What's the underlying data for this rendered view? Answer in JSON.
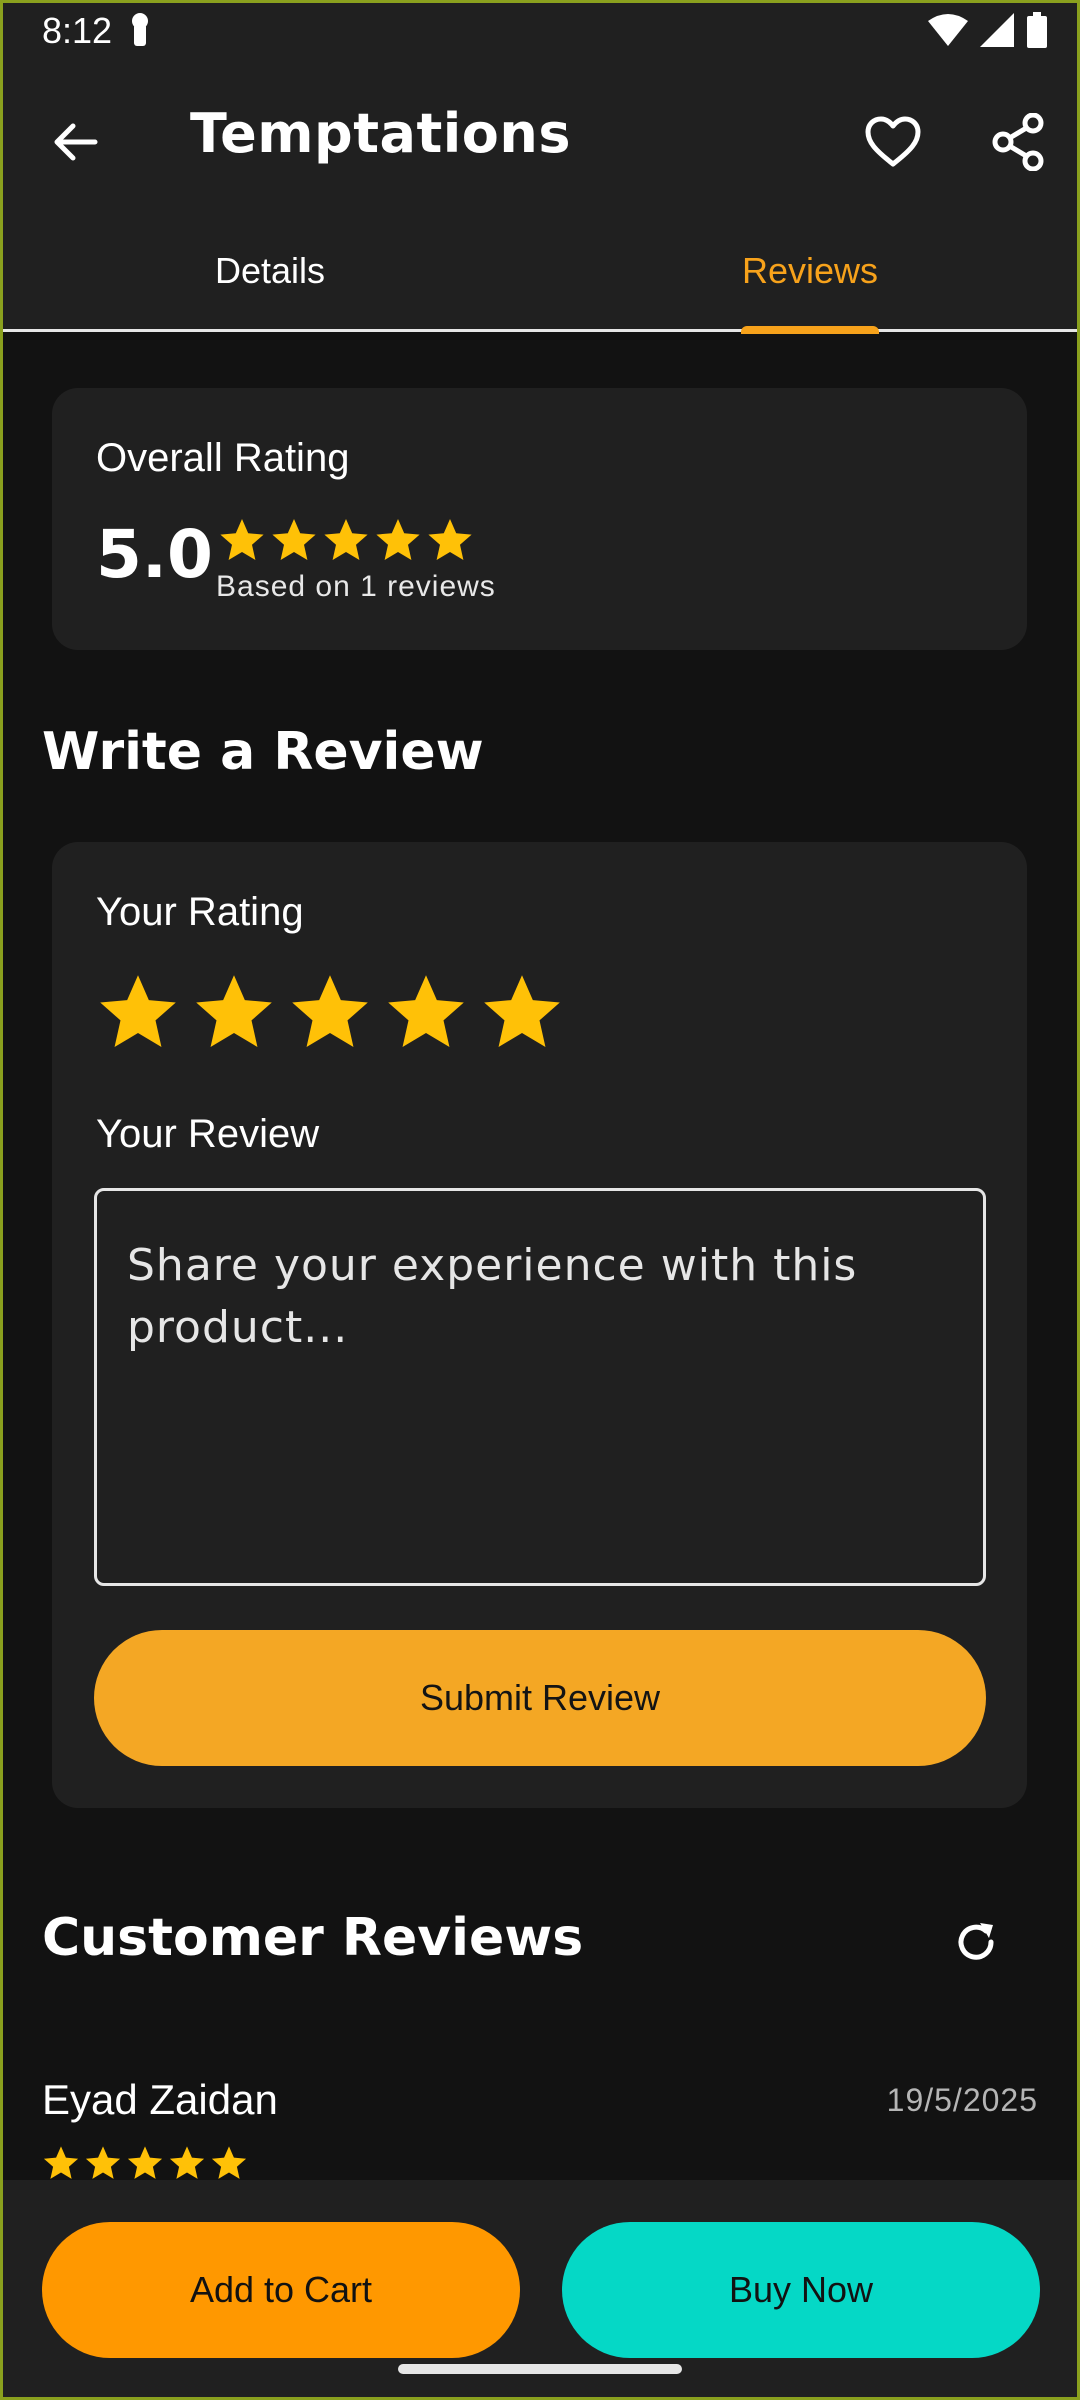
{
  "status_bar": {
    "time": "8:12",
    "icons": [
      "key-icon",
      "wifi-icon",
      "signal-icon",
      "battery-icon"
    ]
  },
  "app_bar": {
    "title": "Temptations",
    "icons": [
      "back-arrow-icon",
      "heart-icon",
      "share-icon"
    ]
  },
  "tabs": [
    {
      "label": "Details",
      "active": false
    },
    {
      "label": "Reviews",
      "active": true
    }
  ],
  "overall": {
    "title": "Overall Rating",
    "score": "5.0",
    "stars": 5,
    "based_on": "Based on 1 reviews"
  },
  "write_review": {
    "title": "Write a Review",
    "rating_label": "Your Rating",
    "rating_value": 5,
    "review_label": "Your Review",
    "placeholder": "Share your experience with this product...",
    "submit_label": "Submit Review"
  },
  "customer_reviews": {
    "title": "Customer Reviews",
    "items": [
      {
        "name": "Eyad Zaidan",
        "date": "19/5/2025",
        "stars": 5
      }
    ]
  },
  "bottom_bar": {
    "add_to_cart": "Add to Cart",
    "buy_now": "Buy Now"
  },
  "colors": {
    "accent": "#f7a21b",
    "star": "#ffc107",
    "buy": "#05d8c6",
    "cart": "#ff9800",
    "background": "#121212",
    "surface": "#202020"
  }
}
